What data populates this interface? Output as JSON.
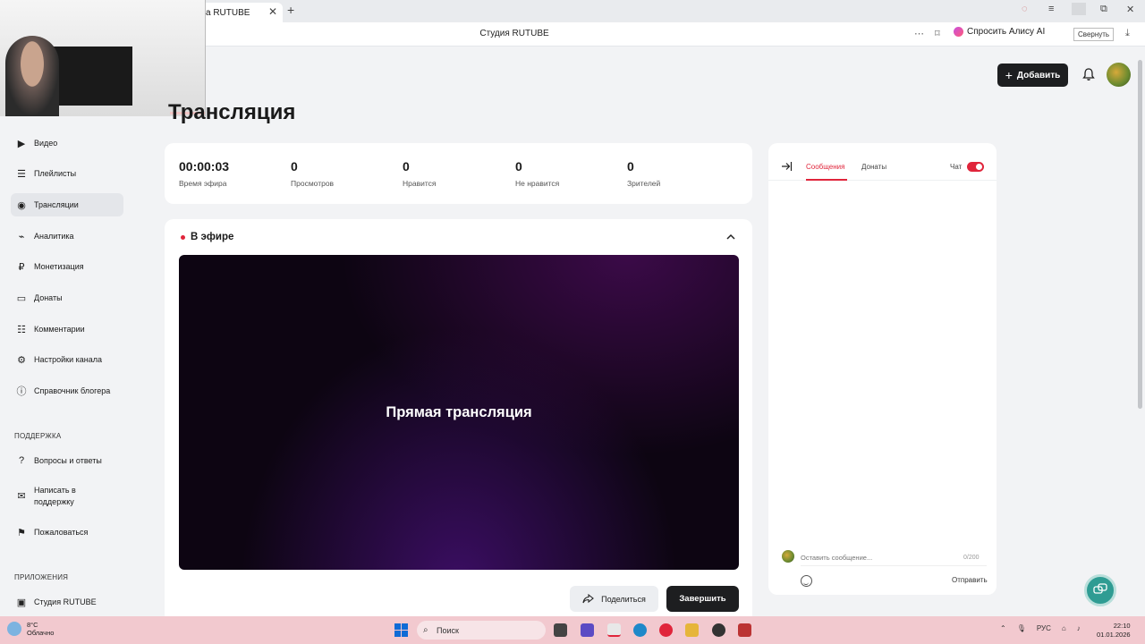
{
  "browser": {
    "tab_title": "Студия RUTUBE",
    "tab_title_visible": "а RUTUBE",
    "new_tab": "+",
    "close_tab": "✕",
    "page_title": "Студия RUTUBE",
    "ask_alice": "Спросить Алису AI",
    "tooltip": "Свернуть"
  },
  "header": {
    "add_button": "Добавить"
  },
  "page": {
    "title": "Трансляция"
  },
  "sidebar": {
    "items": [
      {
        "label": "Видео",
        "icon": "video-icon"
      },
      {
        "label": "Плейлисты",
        "icon": "playlist-icon"
      },
      {
        "label": "Трансляции",
        "icon": "broadcast-icon"
      },
      {
        "label": "Аналитика",
        "icon": "analytics-icon"
      },
      {
        "label": "Монетизация",
        "icon": "ruble-icon"
      },
      {
        "label": "Донаты",
        "icon": "donate-icon"
      },
      {
        "label": "Комментарии",
        "icon": "comment-icon"
      },
      {
        "label": "Настройки канала",
        "icon": "gear-icon"
      },
      {
        "label": "Справочник блогера",
        "icon": "info-icon"
      }
    ],
    "support_label": "ПОДДЕРЖКА",
    "support_items": [
      {
        "label": "Вопросы и ответы",
        "icon": "question-icon"
      },
      {
        "label": "Написать в поддержку",
        "icon": "mail-icon"
      },
      {
        "label": "Пожаловаться",
        "icon": "flag-icon"
      }
    ],
    "apps_label": "ПРИЛОЖЕНИЯ",
    "apps_items": [
      {
        "label": "Студия RUTUBE",
        "icon": "studio-icon"
      }
    ]
  },
  "stats": [
    {
      "value": "00:00:03",
      "label": "Время эфира"
    },
    {
      "value": "0",
      "label": "Просмотров"
    },
    {
      "value": "0",
      "label": "Нравится"
    },
    {
      "value": "0",
      "label": "Не нравится"
    },
    {
      "value": "0",
      "label": "Зрителей"
    }
  ],
  "live": {
    "status": "В эфире",
    "player_text": "Прямая трансляция",
    "share_button": "Поделиться",
    "finish_button": "Завершить"
  },
  "chat": {
    "tab_messages": "Сообщения",
    "tab_donations": "Донаты",
    "chat_label": "Чат",
    "input_placeholder": "Оставить сообщение...",
    "counter": "0/200",
    "send_button": "Отправить"
  },
  "taskbar": {
    "weather_temp": "8°C",
    "weather_desc": "Облачно",
    "search_placeholder": "Поиск",
    "lang": "РУС",
    "time": "22:10",
    "date": "01.01.2026"
  },
  "colors": {
    "accent": "#e0253b",
    "dark_button": "#1d1e20",
    "help_fab": "#2f9c93"
  }
}
